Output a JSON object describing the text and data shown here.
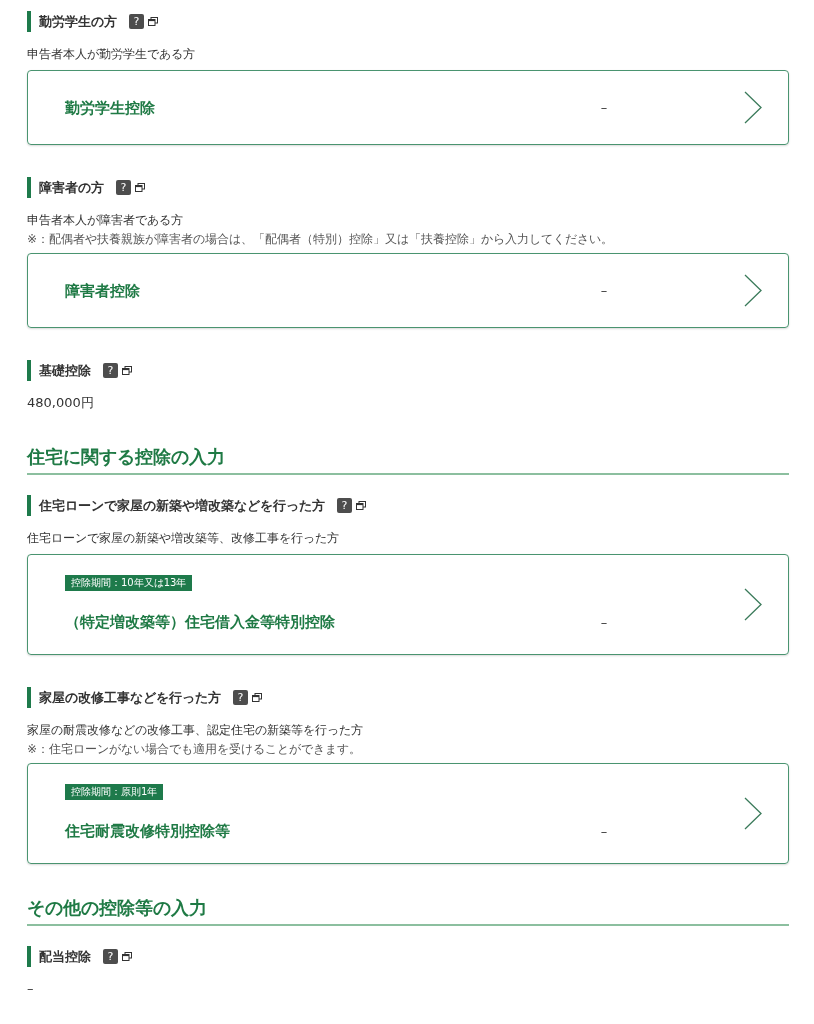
{
  "sections": [
    {
      "kind": "item",
      "heading": "勤労学生の方",
      "help": "?",
      "description": "申告者本人が勤労学生である方",
      "card": {
        "title": "勤労学生控除",
        "value": "–"
      }
    },
    {
      "kind": "item",
      "heading": "障害者の方",
      "help": "?",
      "description": "申告者本人が障害者である方",
      "note": "※：配偶者や扶養親族が障害者の場合は、「配偶者（特別）控除」又は「扶養控除」から入力してください。",
      "card": {
        "title": "障害者控除",
        "value": "–"
      }
    },
    {
      "kind": "item",
      "heading": "基礎控除",
      "help": "?",
      "value": "480,000円"
    },
    {
      "kind": "category",
      "heading": "住宅に関する控除の入力"
    },
    {
      "kind": "item",
      "heading": "住宅ローンで家屋の新築や増改築などを行った方",
      "help": "?",
      "description": "住宅ローンで家屋の新築や増改築等、改修工事を行った方",
      "card": {
        "tag": "控除期間：10年又は13年",
        "title": "（特定増改築等）住宅借入金等特別控除",
        "value": "–"
      }
    },
    {
      "kind": "item",
      "heading": "家屋の改修工事などを行った方",
      "help": "?",
      "description": "家屋の耐震改修などの改修工事、認定住宅の新築等を行った方",
      "note": "※：住宅ローンがない場合でも適用を受けることができます。",
      "card": {
        "tag": "控除期間：原則1年",
        "title": "住宅耐震改修特別控除等",
        "value": "–"
      }
    },
    {
      "kind": "category",
      "heading": "その他の控除等の入力"
    },
    {
      "kind": "item",
      "heading": "配当控除",
      "help": "?",
      "value": "–"
    }
  ]
}
